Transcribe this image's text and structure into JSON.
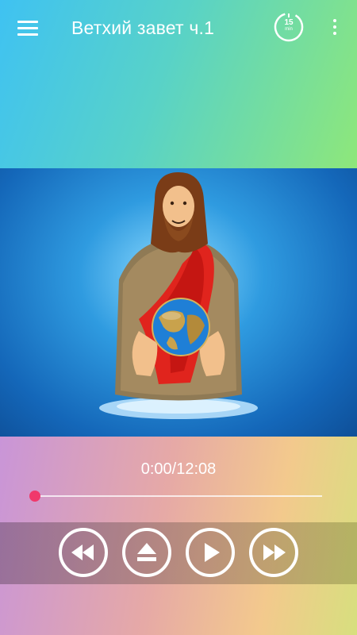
{
  "appbar": {
    "title": "Ветхий завет ч.1",
    "timer_value": "15",
    "timer_unit": "min"
  },
  "player": {
    "time_display": "0:00/12:08",
    "progress": 0
  },
  "controls": {
    "rewind": "rewind-icon",
    "eject": "eject-icon",
    "play": "play-icon",
    "fast_forward": "fast-forward-icon"
  },
  "colors": {
    "seek_thumb": "#f0386b",
    "top_gradient_start": "#3fc2f2",
    "top_gradient_end": "#8ee77a"
  }
}
